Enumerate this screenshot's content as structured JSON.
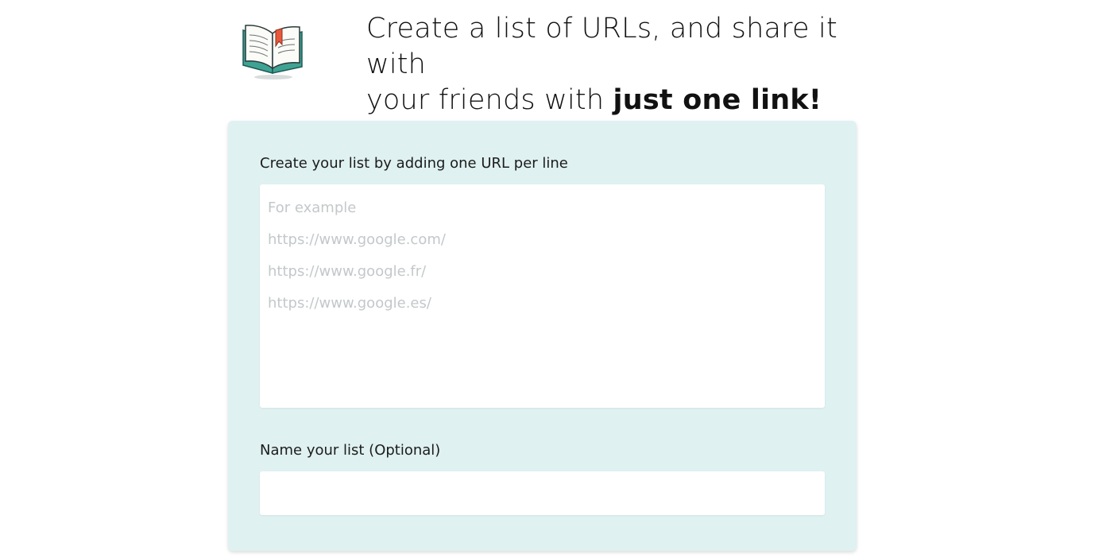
{
  "header": {
    "logo_icon": "open-book-icon",
    "headline_line1": "Create a list of URLs, and share it with",
    "headline_line2_prefix": "your friends with ",
    "headline_emphasis": "just one link!"
  },
  "form": {
    "urls_label": "Create your list by adding one URL per line",
    "urls_placeholder_lines": [
      "For example",
      "https://www.google.com/",
      "https://www.google.fr/",
      "https://www.google.es/"
    ],
    "name_label": "Name your list (Optional)",
    "name_value": ""
  },
  "colors": {
    "card_background": "#dff1f0",
    "book_cover": "#3fa394",
    "bookmark": "#e8583c",
    "placeholder_text": "#c3c8ca"
  }
}
